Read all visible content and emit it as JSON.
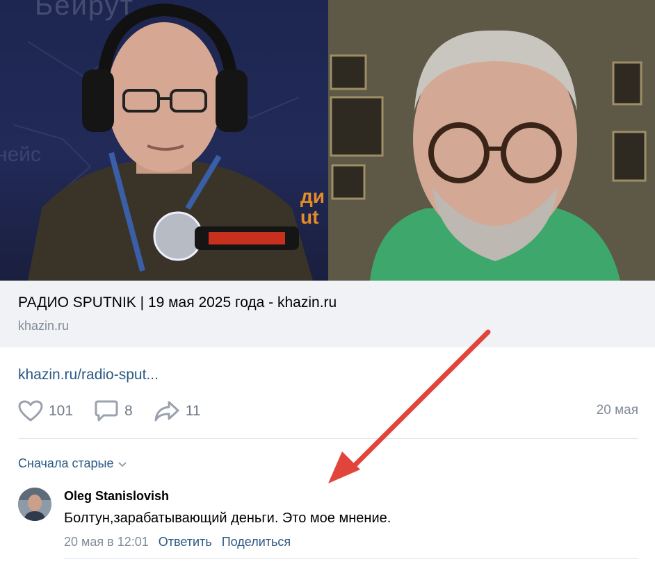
{
  "media": {
    "left_watermark": "Бейрут",
    "left_side_text": "нейс",
    "left_tag": "ди\nut"
  },
  "card": {
    "title": "РАДИО SPUTNIK | 19 мая 2025 года - khazin.ru",
    "domain": "khazin.ru"
  },
  "post": {
    "link_text": "khazin.ru/radio-sput...",
    "likes": "101",
    "comments": "8",
    "shares": "11",
    "date": "20 мая",
    "icons": {
      "like": "heart-icon",
      "comment": "comment-icon",
      "share": "share-icon",
      "sort": "chevron-down-icon"
    }
  },
  "comments": {
    "sort_label": "Сначала старые",
    "items": [
      {
        "author": "Oleg Stanislovish",
        "text": "Болтун,зарабатывающий деньги. Это мое мнение.",
        "time": "20 мая в 12:01",
        "reply_label": "Ответить",
        "share_label": "Поделиться"
      }
    ]
  },
  "colors": {
    "link": "#2a5885",
    "muted": "#818c99",
    "annotation_arrow": "#e0443a",
    "card_bg": "#f0f2f5"
  }
}
